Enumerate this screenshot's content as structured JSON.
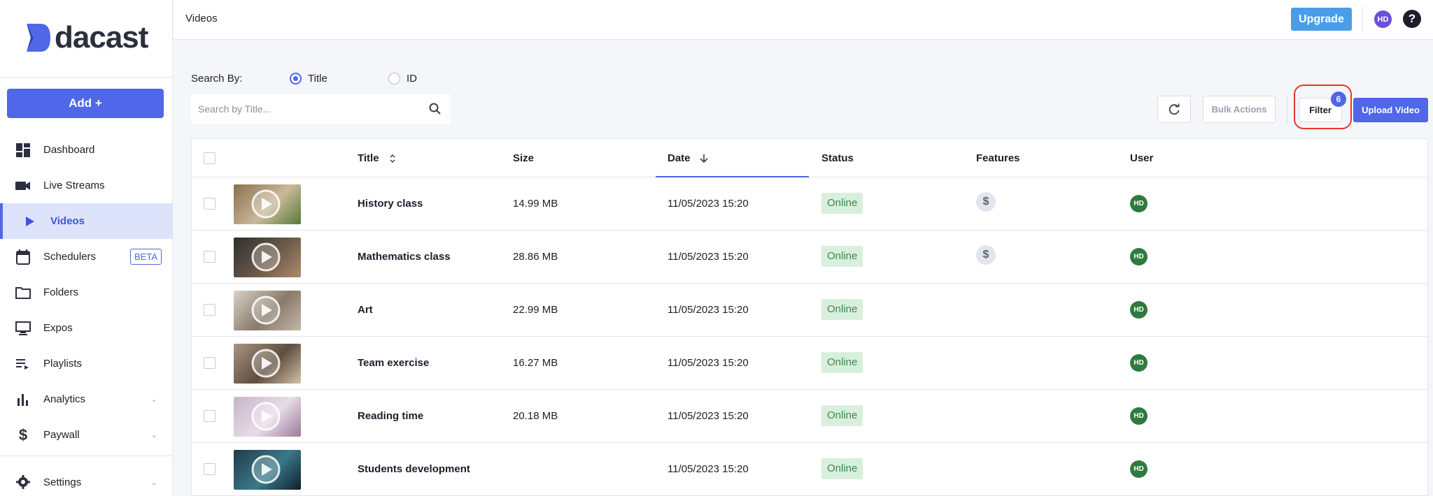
{
  "brand": {
    "name": "dacast"
  },
  "sidebar": {
    "add_label": "Add +",
    "items": [
      {
        "label": "Dashboard",
        "icon": "dashboard-icon"
      },
      {
        "label": "Live Streams",
        "icon": "video-camera-icon"
      },
      {
        "label": "Videos",
        "icon": "play-icon",
        "active": true
      },
      {
        "label": "Schedulers",
        "icon": "calendar-icon",
        "badge": "BETA"
      },
      {
        "label": "Folders",
        "icon": "folder-icon"
      },
      {
        "label": "Expos",
        "icon": "monitor-icon"
      },
      {
        "label": "Playlists",
        "icon": "playlist-icon"
      },
      {
        "label": "Analytics",
        "icon": "bar-chart-icon",
        "expandable": true
      },
      {
        "label": "Paywall",
        "icon": "dollar-icon",
        "expandable": true
      }
    ],
    "settings_label": "Settings"
  },
  "header": {
    "title": "Videos",
    "upgrade_label": "Upgrade",
    "user_initials": "HD",
    "help_label": "?"
  },
  "search": {
    "label": "Search By:",
    "options": [
      "Title",
      "ID"
    ],
    "selected": "Title",
    "placeholder": "Search by Title...",
    "value": ""
  },
  "toolbar": {
    "bulk_actions_label": "Bulk Actions",
    "filter_label": "Filter",
    "filter_count": "6",
    "upload_label": "Upload Video"
  },
  "table": {
    "columns": [
      "Title",
      "Size",
      "Date",
      "Status",
      "Features",
      "User"
    ],
    "rows": [
      {
        "title": "History class",
        "size": "14.99 MB",
        "date": "11/05/2023 15:20",
        "status": "Online",
        "paywall": true,
        "user": "HD",
        "thumb": [
          "#8b6f4e",
          "#c9b89a",
          "#5a7a3c"
        ]
      },
      {
        "title": "Mathematics class",
        "size": "28.86 MB",
        "date": "11/05/2023 15:20",
        "status": "Online",
        "paywall": true,
        "user": "HD",
        "thumb": [
          "#2e2e2e",
          "#6b5a4a",
          "#b08a6a"
        ]
      },
      {
        "title": "Art",
        "size": "22.99 MB",
        "date": "11/05/2023 15:20",
        "status": "Online",
        "paywall": false,
        "user": "HD",
        "thumb": [
          "#d8d2c8",
          "#8a7a6a",
          "#c4b8a8"
        ]
      },
      {
        "title": "Team exercise",
        "size": "16.27 MB",
        "date": "11/05/2023 15:20",
        "status": "Online",
        "paywall": false,
        "user": "HD",
        "thumb": [
          "#a89680",
          "#5e4e3e",
          "#d4c2a8"
        ]
      },
      {
        "title": "Reading time",
        "size": "20.18 MB",
        "date": "11/05/2023 15:20",
        "status": "Online",
        "paywall": false,
        "user": "HD",
        "thumb": [
          "#c8b4c8",
          "#e8dce8",
          "#9a7a9a"
        ]
      },
      {
        "title": "Students development",
        "size": "",
        "date": "11/05/2023 15:20",
        "status": "Online",
        "paywall": false,
        "user": "HD",
        "thumb": [
          "#1e3a4a",
          "#3a7a8a",
          "#0e1e2a"
        ]
      }
    ]
  },
  "colors": {
    "primary": "#4f67e8",
    "upgrade": "#4b9de8",
    "online_bg": "#d9efdd",
    "online_text": "#3b8a4a",
    "user_avatar": "#2f7a3e",
    "highlight_ring": "#e8362b"
  }
}
